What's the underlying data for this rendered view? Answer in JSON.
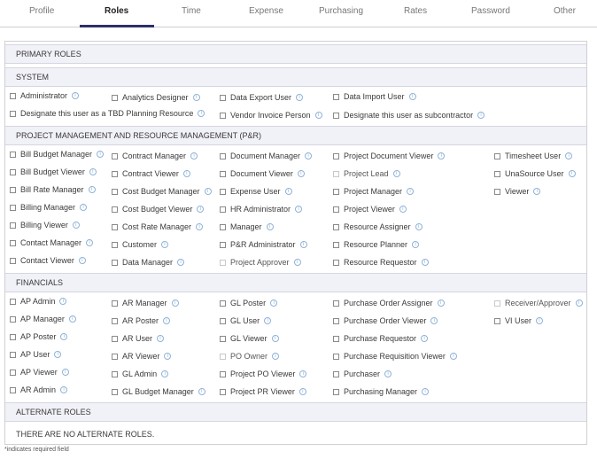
{
  "tabs": [
    "Profile",
    "Roles",
    "Time",
    "Expense",
    "Purchasing",
    "Rates",
    "Password",
    "Other"
  ],
  "active_tab": "Roles",
  "sections": {
    "primary": "PRIMARY ROLES",
    "system": "SYSTEM",
    "pm": "PROJECT MANAGEMENT AND RESOURCE MANAGEMENT (P&R)",
    "financials": "FINANCIALS",
    "alternate": "ALTERNATE ROLES"
  },
  "system_roles": [
    "Administrator",
    "Analytics Designer",
    "Data Export User",
    "Data Import User",
    "Designate this user as a TBD Planning Resource",
    "Vendor Invoice Person",
    "Designate this user as subcontractor"
  ],
  "pm_roles": [
    "Bill Budget Manager",
    "Bill Budget Viewer",
    "Bill Rate Manager",
    "Billing Manager",
    "Billing Viewer",
    "Contact Manager",
    "Contact Viewer",
    "Contract Manager",
    "Contract Viewer",
    "Cost Budget Manager",
    "Cost Budget Viewer",
    "Cost Rate Manager",
    "Customer",
    "Data Manager",
    "Document Manager",
    "Document Viewer",
    "Expense User",
    "HR Administrator",
    "Manager",
    "P&R Administrator",
    "Project Approver",
    "Project Document Viewer",
    "Project Lead",
    "Project Manager",
    "Project Viewer",
    "Resource Assigner",
    "Resource Planner",
    "Resource Requestor",
    "Timesheet User",
    "UnaSource User",
    "Viewer"
  ],
  "fin_roles": [
    "AP Admin",
    "AP Manager",
    "AP Poster",
    "AP User",
    "AP Viewer",
    "AR Admin",
    "AR Manager",
    "AR Poster",
    "AR User",
    "AR Viewer",
    "GL Admin",
    "GL Budget Manager",
    "GL Poster",
    "GL User",
    "GL Viewer",
    "PO Owner",
    "Project PO Viewer",
    "Project PR Viewer",
    "Purchase Order Assigner",
    "Purchase Order Viewer",
    "Purchase Requestor",
    "Purchase Requisition Viewer",
    "Purchaser",
    "Purchasing Manager",
    "Receiver/Approver",
    "VI User"
  ],
  "alternate_note": "THERE ARE NO ALTERNATE ROLES.",
  "footnote": "*indicates required field"
}
